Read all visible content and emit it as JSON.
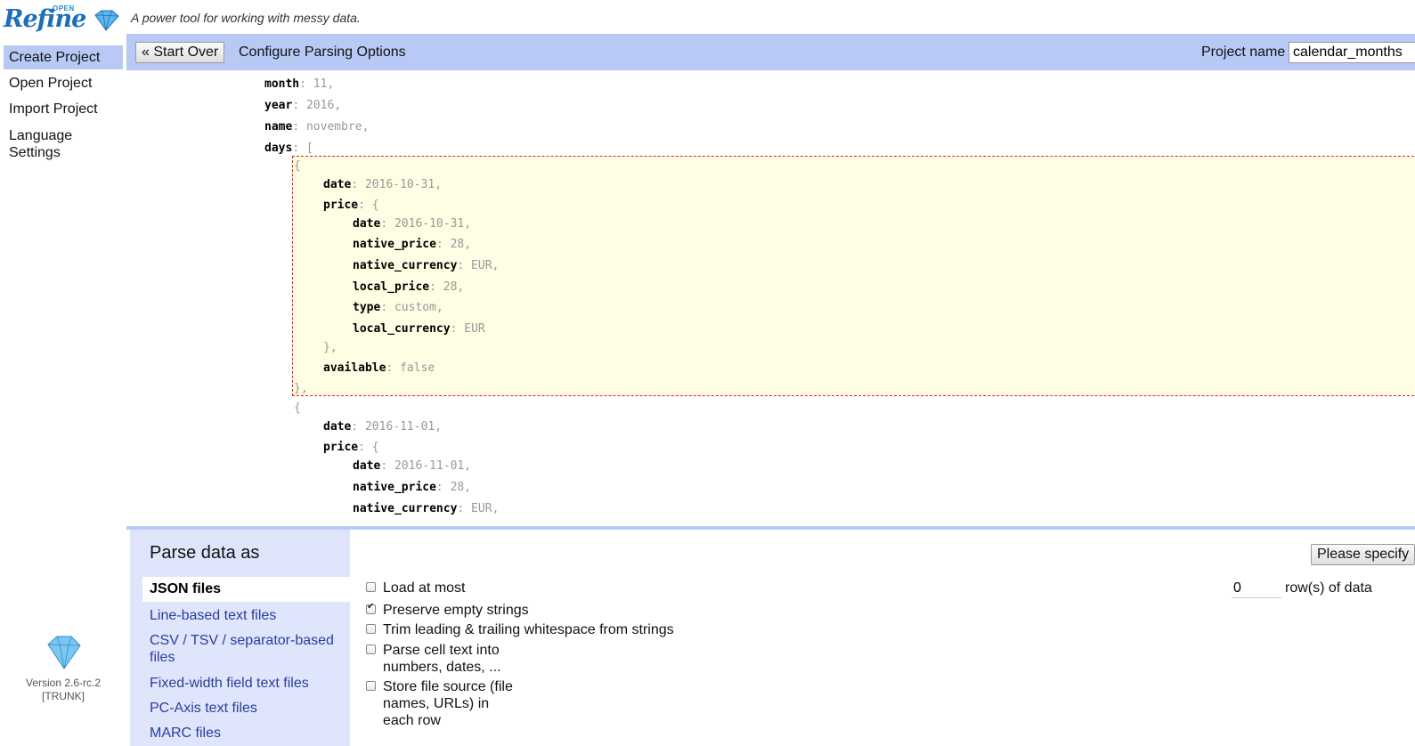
{
  "header": {
    "logo_small": "OPEN",
    "logo_big": "Refine",
    "tagline": "A power tool for working with messy data."
  },
  "nav": {
    "items": [
      "Create Project",
      "Open Project",
      "Import Project",
      "Language Settings"
    ],
    "active": "Create Project",
    "version_line1": "Version 2.6-rc.2",
    "version_line2": "[TRUNK]"
  },
  "toolbar": {
    "start_over": "« Start Over",
    "title": "Configure Parsing Options",
    "project_name_label": "Project name",
    "project_name_value": "calendar_months"
  },
  "preview": {
    "lines": [
      {
        "key": "month",
        "rest": ": 11,"
      },
      {
        "key": "year",
        "rest": ": 2016,"
      },
      {
        "key": "name",
        "rest": ": novembre,"
      },
      {
        "key": "days",
        "rest": ": ["
      },
      {
        "key": "",
        "rest": "{"
      },
      {
        "key": "date",
        "rest": ": 2016-10-31,"
      },
      {
        "key": "price",
        "rest": ": {"
      },
      {
        "key": "date",
        "rest": ": 2016-10-31,"
      },
      {
        "key": "native_price",
        "rest": ": 28,"
      },
      {
        "key": "native_currency",
        "rest": ": EUR,"
      },
      {
        "key": "local_price",
        "rest": ": 28,"
      },
      {
        "key": "type",
        "rest": ": custom,"
      },
      {
        "key": "local_currency",
        "rest": ": EUR"
      },
      {
        "key": "",
        "rest": "},"
      },
      {
        "key": "available",
        "rest": ": false"
      },
      {
        "key": "",
        "rest": "},"
      },
      {
        "key": "",
        "rest": "{"
      },
      {
        "key": "date",
        "rest": ": 2016-11-01,"
      },
      {
        "key": "price",
        "rest": ": {"
      },
      {
        "key": "date",
        "rest": ": 2016-11-01,"
      },
      {
        "key": "native_price",
        "rest": ": 28,"
      },
      {
        "key": "native_currency",
        "rest": ": EUR,"
      }
    ]
  },
  "parse": {
    "title": "Parse data as",
    "formats": [
      "JSON files",
      "Line-based text files",
      "CSV / TSV / separator-based files",
      "Fixed-width field text files",
      "PC-Axis text files",
      "MARC files"
    ],
    "selected_format": "JSON files",
    "options": [
      {
        "label": "Load at most",
        "checked": false
      },
      {
        "label": "Preserve empty strings",
        "checked": true
      },
      {
        "label": "Trim leading & trailing whitespace from strings",
        "checked": false
      },
      {
        "label": "Parse cell text into numbers, dates, ...",
        "checked": false
      },
      {
        "label": "Store file source (file names, URLs) in each row",
        "checked": false
      }
    ],
    "rows_value": "0",
    "rows_label": "row(s) of data",
    "please_specify": "Please specify"
  },
  "colors": {
    "accent_bar": "#b8c9f6",
    "panel_bg": "#dfe6fb",
    "highlight_bg": "#fffde3",
    "highlight_border": "#e02020",
    "link": "#2a3d9e"
  }
}
